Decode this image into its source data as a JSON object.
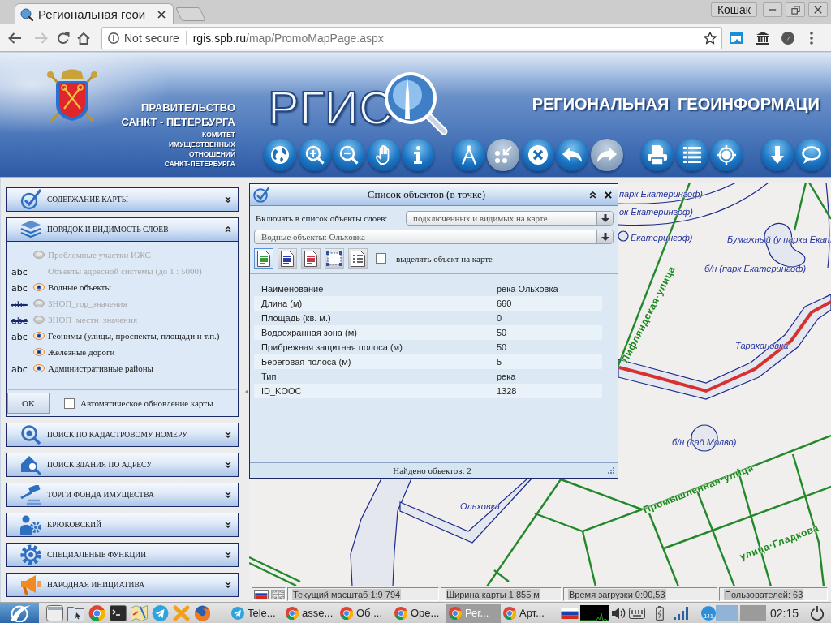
{
  "browser": {
    "tabs": [
      {
        "title": "Региональная геои",
        "selected": true
      }
    ],
    "profile": "Кошак",
    "nav": [
      {
        "kind": "back",
        "disabled": false
      },
      {
        "kind": "forward",
        "disabled": true
      },
      {
        "kind": "reload",
        "disabled": false
      },
      {
        "kind": "home",
        "disabled": false
      }
    ],
    "security": "Not secure",
    "url_host": "rgis.spb.ru",
    "url_path": "/map/PromoMapPage.aspx"
  },
  "banner": {
    "government": [
      "ПРАВИТЕЛЬСТВО",
      "САНКТ - ПЕТЕРБУРГА"
    ],
    "committee": [
      "КОМИТЕТ",
      "ИМУЩЕСТВЕННЫХ",
      "ОТНОШЕНИЙ",
      "САНКТ-ПЕТЕРБУРГА"
    ],
    "logo": "РГИС",
    "title": "РЕГИОНАЛЬНАЯ ГЕОИНФОРМАЦИ",
    "toolbar": [
      {
        "buttons": [
          {
            "kind": "globe",
            "disabled": false
          },
          {
            "kind": "zoomin",
            "disabled": false
          },
          {
            "kind": "zoomout",
            "disabled": false
          },
          {
            "kind": "hand",
            "disabled": false
          },
          {
            "kind": "info",
            "disabled": false
          }
        ]
      },
      {
        "buttons": [
          {
            "kind": "dividers",
            "disabled": false
          },
          {
            "kind": "select",
            "disabled": true
          },
          {
            "kind": "clear",
            "disabled": false
          },
          {
            "kind": "undo",
            "disabled": false
          },
          {
            "kind": "redo",
            "disabled": true
          }
        ]
      },
      {
        "buttons": [
          {
            "kind": "print",
            "disabled": false
          },
          {
            "kind": "list",
            "disabled": false
          },
          {
            "kind": "target",
            "disabled": false
          }
        ]
      },
      {
        "buttons": [
          {
            "kind": "download",
            "disabled": false
          },
          {
            "kind": "chat",
            "disabled": false
          }
        ]
      }
    ]
  },
  "sidebar": {
    "sections": [
      {
        "title": "СОДЕРЖАНИЕ КАРТЫ",
        "kind": "check",
        "expanded": false
      },
      {
        "title": "ПОРЯДОК И ВИДИМОСТЬ СЛОЕВ",
        "kind": "layers",
        "expanded": true,
        "layers": [
          {
            "name": "Проблемные участки ИЖС",
            "disabled": true,
            "visible": false
          },
          {
            "name": "Объекты адресной системы (до 1 : 5000)",
            "disabled": true,
            "labels": {
              "text": "abc",
              "on": true
            }
          },
          {
            "name": "Водные объекты",
            "disabled": false,
            "visible": true,
            "labels": {
              "text": "abc",
              "on": true
            }
          },
          {
            "name": "ЗНОП_гор_значения",
            "disabled": true,
            "visible": false,
            "labels": {
              "text": "abc",
              "on": false
            }
          },
          {
            "name": "ЗНОП_местн_значения",
            "disabled": true,
            "visible": false,
            "labels": {
              "text": "abc",
              "on": false
            }
          },
          {
            "name": "Геонимы (улицы, проспекты, площади и т.п.)",
            "disabled": false,
            "visible": true,
            "labels": {
              "text": "abc",
              "on": true
            }
          },
          {
            "name": "Железные дороги",
            "disabled": false,
            "visible": true
          },
          {
            "name": "Административные районы",
            "disabled": false,
            "visible": true,
            "labels": {
              "text": "abc",
              "on": true
            }
          }
        ],
        "ok_button": "OK",
        "auto_update": {
          "label": "Автоматическое обновление карты",
          "checked": false
        }
      },
      {
        "title": "ПОИСК ПО КАДАСТРОВОМУ НОМЕРУ",
        "kind": "cadastre",
        "expanded": false
      },
      {
        "title": "ПОИСК ЗДАНИЯ ПО АДРЕСУ",
        "kind": "address",
        "expanded": false
      },
      {
        "title": "ТОРГИ ФОНДА ИМУЩЕСТВА",
        "kind": "auction",
        "expanded": false
      },
      {
        "title": "КРЮКОВСКИЙ",
        "kind": "person",
        "expanded": false
      },
      {
        "title": "СПЕЦИАЛЬНЫЕ ФУНКЦИИ",
        "kind": "gear",
        "expanded": false
      },
      {
        "title": "НАРОДНАЯ ИНИЦИАТИВА",
        "kind": "megaphone",
        "expanded": false
      }
    ]
  },
  "dialog": {
    "title": "Список объектов (в точке)",
    "filter_label": "Включать в список объекты слоев:",
    "filter_value": "подключенных и видимых на карте",
    "object_value": "Водные объекты: Ольховка",
    "tools": [
      {
        "kind": "document",
        "color": "#3a9a3a",
        "selected": true
      },
      {
        "kind": "document",
        "color": "#2a3aa8",
        "selected": false
      },
      {
        "kind": "document",
        "color": "#c8364a",
        "selected": false
      },
      {
        "kind": "selection",
        "selected": false
      },
      {
        "kind": "table",
        "selected": false
      }
    ],
    "highlight": {
      "label": "выделять объект на карте",
      "checked": false
    },
    "attributes": [
      {
        "name": "Наименование",
        "value": "река Ольховка"
      },
      {
        "name": "Длина (м)",
        "value": "660"
      },
      {
        "name": "Площадь (кв. м.)",
        "value": "0"
      },
      {
        "name": "Водоохранная зона (м)",
        "value": "50"
      },
      {
        "name": "Прибрежная защитная полоса (м)",
        "value": "50"
      },
      {
        "name": "Береговая полоса (м)",
        "value": "5"
      },
      {
        "name": "Тип",
        "value": "река"
      },
      {
        "name": "ID_KOOC",
        "value": "1328"
      }
    ],
    "footer": "Найдено объектов: 2"
  },
  "map": {
    "labels": [
      {
        "text": "парк Екатерингоф)",
        "kind": "water"
      },
      {
        "text": "ок Екатерингоф)",
        "kind": "water"
      },
      {
        "text": "Екатерингоф)",
        "kind": "water"
      },
      {
        "text": "Бумажный (у парка Екат",
        "kind": "water"
      },
      {
        "text": "б/н (парк Екатерингоф)",
        "kind": "water"
      },
      {
        "text": "Лифляндская·улица",
        "kind": "street"
      },
      {
        "text": "Тараканoвка",
        "kind": "water"
      },
      {
        "text": "б/н (сад Молво)",
        "kind": "water"
      },
      {
        "text": "Ольховка",
        "kind": "water"
      },
      {
        "text": "Промышленная·улица",
        "kind": "street"
      },
      {
        "text": "улица·Гладкова",
        "kind": "street"
      }
    ],
    "status": {
      "languages": [
        {
          "kind": "ru",
          "selected": true
        },
        {
          "kind": "en",
          "selected": false
        }
      ],
      "fields": [
        "Текущий масштаб 1:9 794",
        "Ширина карты 1 855 м",
        "Время загрузки 0:00,53",
        "Пользователей: 63"
      ]
    }
  },
  "taskbar": {
    "launchers": [
      {
        "kind": "window"
      },
      {
        "kind": "files"
      },
      {
        "kind": "chrome"
      },
      {
        "kind": "terminal"
      },
      {
        "kind": "map"
      },
      {
        "kind": "telegram"
      },
      {
        "kind": "xapp"
      },
      {
        "kind": "firefox"
      }
    ],
    "windows": [
      {
        "title": "Tele...",
        "kind": "telegram",
        "selected": false
      },
      {
        "title": "asse...",
        "kind": "chrome",
        "selected": false
      },
      {
        "title": "Об ...",
        "kind": "chrome",
        "selected": false
      },
      {
        "title": "Ope...",
        "kind": "chrome",
        "selected": false
      },
      {
        "title": "Рег...",
        "kind": "chrome",
        "selected": true
      },
      {
        "title": "Арт...",
        "kind": "chrome",
        "selected": false
      }
    ],
    "notification_count": "141",
    "workspaces": [
      {
        "selected": true
      },
      {
        "selected": false
      }
    ],
    "clock": "02:15"
  }
}
